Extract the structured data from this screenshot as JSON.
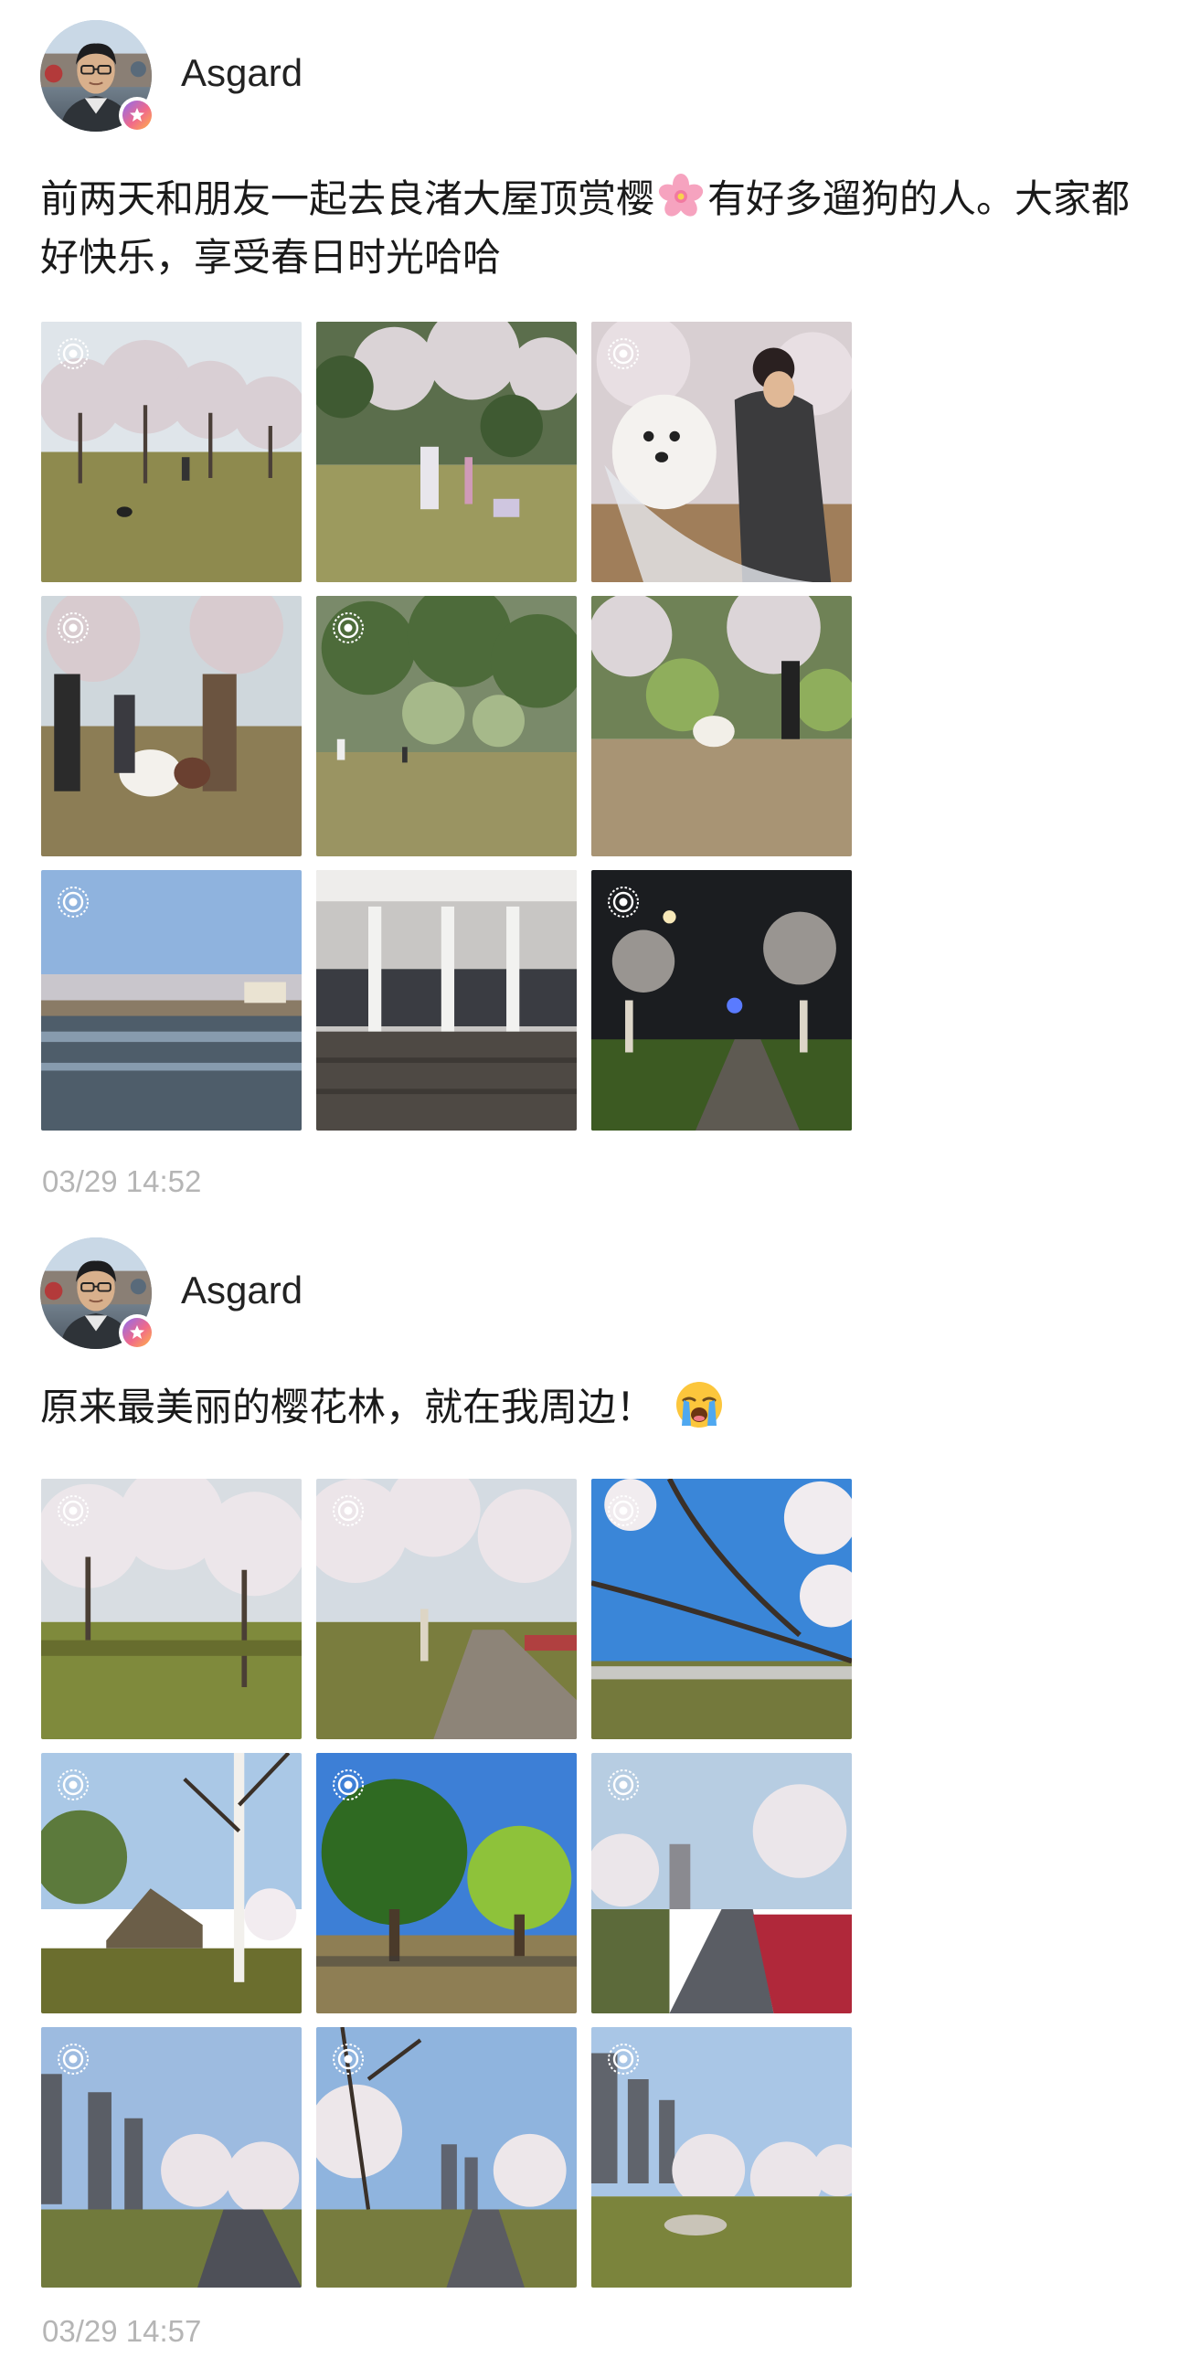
{
  "posts": [
    {
      "username": "Asgard",
      "text_before": "前两天和朋友一起去良渚大屋顶赏樱",
      "emoji_icon": "cherry-blossom-emoji",
      "text_after": "有好多遛狗的人。大家都好快乐，享受春日时光哈哈",
      "timestamp": "03/29 14:52",
      "photo_count": 9,
      "photos": [
        {
          "subject": "cherry-trees-lawn-person-dog",
          "live": true
        },
        {
          "subject": "park-photographer-tripod",
          "live": false
        },
        {
          "subject": "woman-samoyed-umbrella",
          "live": true
        },
        {
          "subject": "people-with-samoyed-crowd",
          "live": true
        },
        {
          "subject": "park-lawn-willows",
          "live": true
        },
        {
          "subject": "woman-walking-dog",
          "live": false
        },
        {
          "subject": "reflecting-pool-sky",
          "live": true
        },
        {
          "subject": "building-canopy-interior",
          "live": false
        },
        {
          "subject": "night-cherry-path-lamps",
          "live": true
        }
      ]
    },
    {
      "username": "Asgard",
      "text_before": "原来最美丽的樱花林，就在我周边！",
      "emoji_icon": "crying-face-emoji",
      "text_after": "",
      "timestamp": "03/29 14:57",
      "photo_count": 9,
      "photos": [
        {
          "subject": "cherry-blossom-lawn",
          "live": true
        },
        {
          "subject": "cherry-blossom-path",
          "live": true
        },
        {
          "subject": "cherry-branches-blue-sky",
          "live": true
        },
        {
          "subject": "tent-under-trees",
          "live": true
        },
        {
          "subject": "green-trees-picnic",
          "live": true
        },
        {
          "subject": "road-red-flowers-buildings",
          "live": true
        },
        {
          "subject": "buildings-cherry-road",
          "live": true
        },
        {
          "subject": "cherry-path-towers",
          "live": true
        },
        {
          "subject": "park-buildings-picnic",
          "live": true
        }
      ]
    }
  ],
  "colors": {
    "text": "#1a1a1a",
    "username": "#222222",
    "timestamp": "#b5b5b5",
    "background": "#ffffff"
  }
}
